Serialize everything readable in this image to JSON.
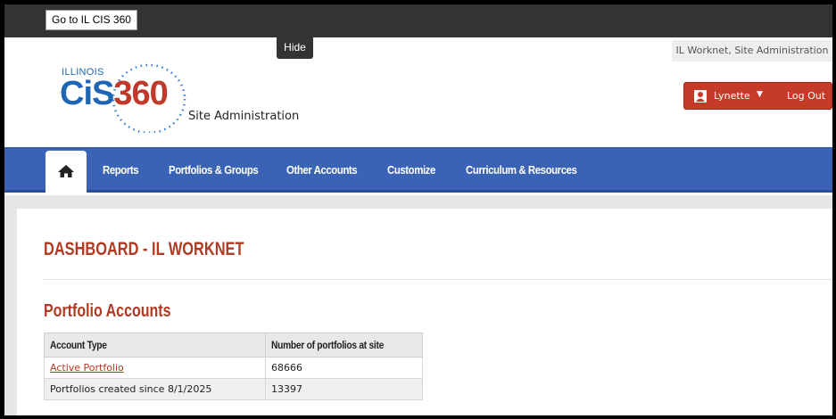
{
  "topbar": {
    "goto_label": "Go to IL CIS 360",
    "hide_label": "Hide"
  },
  "header": {
    "logo": {
      "state": "ILLINOIS",
      "brand_letters": "CiS",
      "brand_number": "360"
    },
    "site_title": "Site Administration",
    "account_label": "IL Worknet, Site Administration",
    "user": {
      "name": "Lynette",
      "logout_label": "Log Out"
    }
  },
  "nav": {
    "items": [
      {
        "label": "Reports"
      },
      {
        "label": "Portfolios & Groups"
      },
      {
        "label": "Other Accounts"
      },
      {
        "label": "Customize"
      },
      {
        "label": "Curriculum & Resources"
      }
    ]
  },
  "main": {
    "dashboard_title": "DASHBOARD - IL WORKNET",
    "section_title": "Portfolio Accounts",
    "table": {
      "headers": [
        "Account Type",
        "Number of portfolios at site"
      ],
      "rows": [
        {
          "type": "Active Portfolio",
          "count": "68666",
          "link": true
        },
        {
          "type": "Portfolios created since 8/1/2025",
          "count": "13397",
          "link": false
        }
      ]
    }
  },
  "colors": {
    "nav_blue": "#3a62b5",
    "accent_red": "#b03a22",
    "user_button": "#c63a28"
  }
}
